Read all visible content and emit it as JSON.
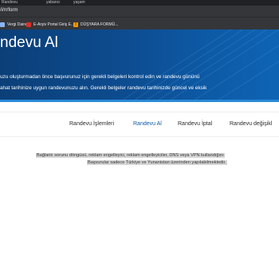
{
  "browser": {
    "tabs": [
      "Randevu",
      "yabancı",
      "yaşam"
    ],
    "url": "/i/rr/form",
    "bookmarks": [
      {
        "label": "Vergi Dairesi",
        "icon": "bank-icon",
        "color": "#8ab4f8"
      },
      {
        "label": "E-Arşiv Portal Giriş E...",
        "icon": "portal-icon",
        "color": "#d93025"
      },
      {
        "label": "DÜŞYARA FORMÜ...",
        "icon": "warning-icon",
        "color": "#f29900"
      }
    ]
  },
  "hero": {
    "title": "ndevu Al",
    "line1": "uzu oluşturmadan önce başvurunuz için gerekli belgeleri kontrol edin ve randevu gününü",
    "line2": "ahat tarihinize uygun randevunuzu alın. Gerekli belgeler randevu tarihinizde güncel ve eksik"
  },
  "nav": {
    "items": [
      {
        "label": "Randevu İşlemleri",
        "active": false
      },
      {
        "label": "Randevu Al",
        "active": true
      },
      {
        "label": "Randevu İptal",
        "active": false
      },
      {
        "label": "Randevu değişikl",
        "active": false
      }
    ]
  },
  "notice": {
    "line1": "Bağlantı sorunu döngüsü, reklam engelleyici, reklam engelleyiciler, DNS veya VPN kullandığını",
    "line2": "Başvurular sadece Türkiye ve Yunanistan üzerinden yapılabilmektedir."
  },
  "colors": {
    "hero": "#0d4c90",
    "active_nav": "#0d5aa6"
  }
}
